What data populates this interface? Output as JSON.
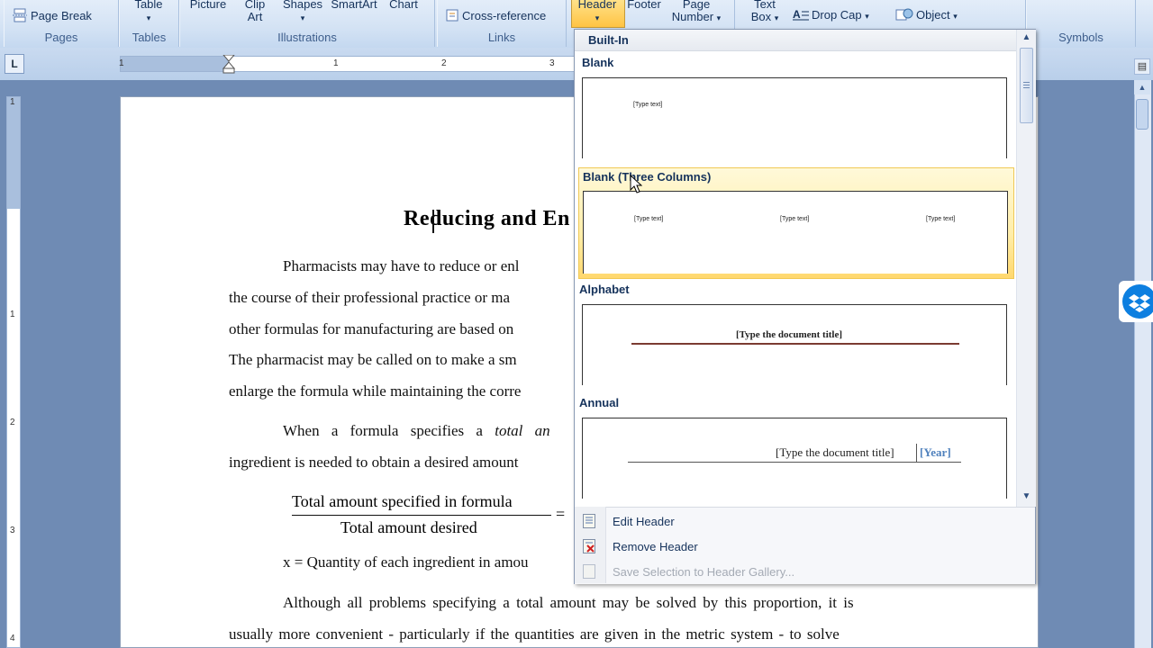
{
  "ribbon": {
    "page_break": "Page Break",
    "pages_group": "Pages",
    "table": "Table",
    "tables_group": "Tables",
    "picture": "Picture",
    "clip_art": "Clip Art",
    "clip_art_l1": "Clip",
    "clip_art_l2": "Art",
    "shapes": "Shapes",
    "smartart": "SmartArt",
    "chart": "Chart",
    "illustrations_group": "Illustrations",
    "cross_reference": "Cross-reference",
    "links_group": "Links",
    "header": "Header",
    "footer": "Footer",
    "page_number_l1": "Page",
    "page_number_l2": "Number",
    "text_box_l1": "Text",
    "text_box_l2": "Box",
    "drop_cap": "Drop Cap",
    "object": "Object",
    "symbols_group": "Symbols"
  },
  "ruler": {
    "h_numbers": [
      "1",
      "1",
      "2",
      "3"
    ],
    "v_numbers": [
      "1",
      "1",
      "2",
      "3",
      "4"
    ]
  },
  "document": {
    "title": "Reducing and En",
    "lines": [
      "Pharmacists may have to reduce or enl",
      "the course of their professional practice or ma",
      "other formulas for manufacturing are based on",
      "The pharmacist may be called on to make a sm",
      "enlarge the formula while maintaining the corre"
    ],
    "para2_line1_a": "When a formula specifies a ",
    "para2_line1_b": "total an",
    "para2_line2": "ingredient is needed to obtain a desired amount",
    "fraction_num": "Total amount specified in formula",
    "fraction_den": "Total amount desired",
    "fraction_eq": "=",
    "x_line": "x = Quantity of each ingredient in amou",
    "para3_line1": "Although all problems specifying a total amount may be solved by this proportion, it is",
    "para3_line2": "usually more convenient - particularly if the quantities are given in the metric system - to solve"
  },
  "gallery": {
    "heading": "Built-In",
    "items": [
      {
        "label": "Blank",
        "texts": [
          "[Type text]"
        ]
      },
      {
        "label": "Blank (Three Columns)",
        "texts": [
          "[Type text]",
          "[Type text]",
          "[Type text]"
        ]
      },
      {
        "label": "Alphabet",
        "texts": [
          "[Type the document title]"
        ]
      },
      {
        "label": "Annual",
        "texts": [
          "[Type the document title]",
          "[Year]"
        ]
      }
    ],
    "menu": {
      "edit_header": "Edit Header",
      "remove_header": "Remove Header",
      "save_selection": "Save Selection to Header Gallery..."
    }
  },
  "colors": {
    "ribbon_text": "#15325b",
    "highlight": "#ffe28a",
    "alphabet_rule": "#7b3b32",
    "annual_year": "#4f81bd",
    "dropbox": "#0d7fe0"
  }
}
